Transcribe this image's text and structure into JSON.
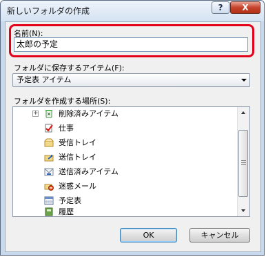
{
  "window": {
    "title": "新しいフォルダの作成",
    "help_label": "?",
    "close_label": "X"
  },
  "name_field": {
    "label": "名前(N):",
    "value": "太郎の予定"
  },
  "item_type": {
    "label": "フォルダに保存するアイテム(F):",
    "selected": "予定表 アイテム"
  },
  "location": {
    "label": "フォルダを作成する場所(S):",
    "items": [
      {
        "label": "削除済みアイテム",
        "icon": "deleted-items-icon",
        "expander": "+"
      },
      {
        "label": "仕事",
        "icon": "tasks-icon"
      },
      {
        "label": "受信トレイ",
        "icon": "inbox-icon"
      },
      {
        "label": "送信トレイ",
        "icon": "outbox-icon"
      },
      {
        "label": "送信済みアイテム",
        "icon": "sent-items-icon"
      },
      {
        "label": "迷惑メール",
        "icon": "junk-mail-icon"
      },
      {
        "label": "予定表",
        "icon": "calendar-icon",
        "selected": true
      },
      {
        "label": "履歴",
        "icon": "journal-icon"
      }
    ]
  },
  "buttons": {
    "ok": "OK",
    "cancel": "キャンセル"
  },
  "colors": {
    "highlight": "#e2001a",
    "selection": "#cde8ff"
  }
}
